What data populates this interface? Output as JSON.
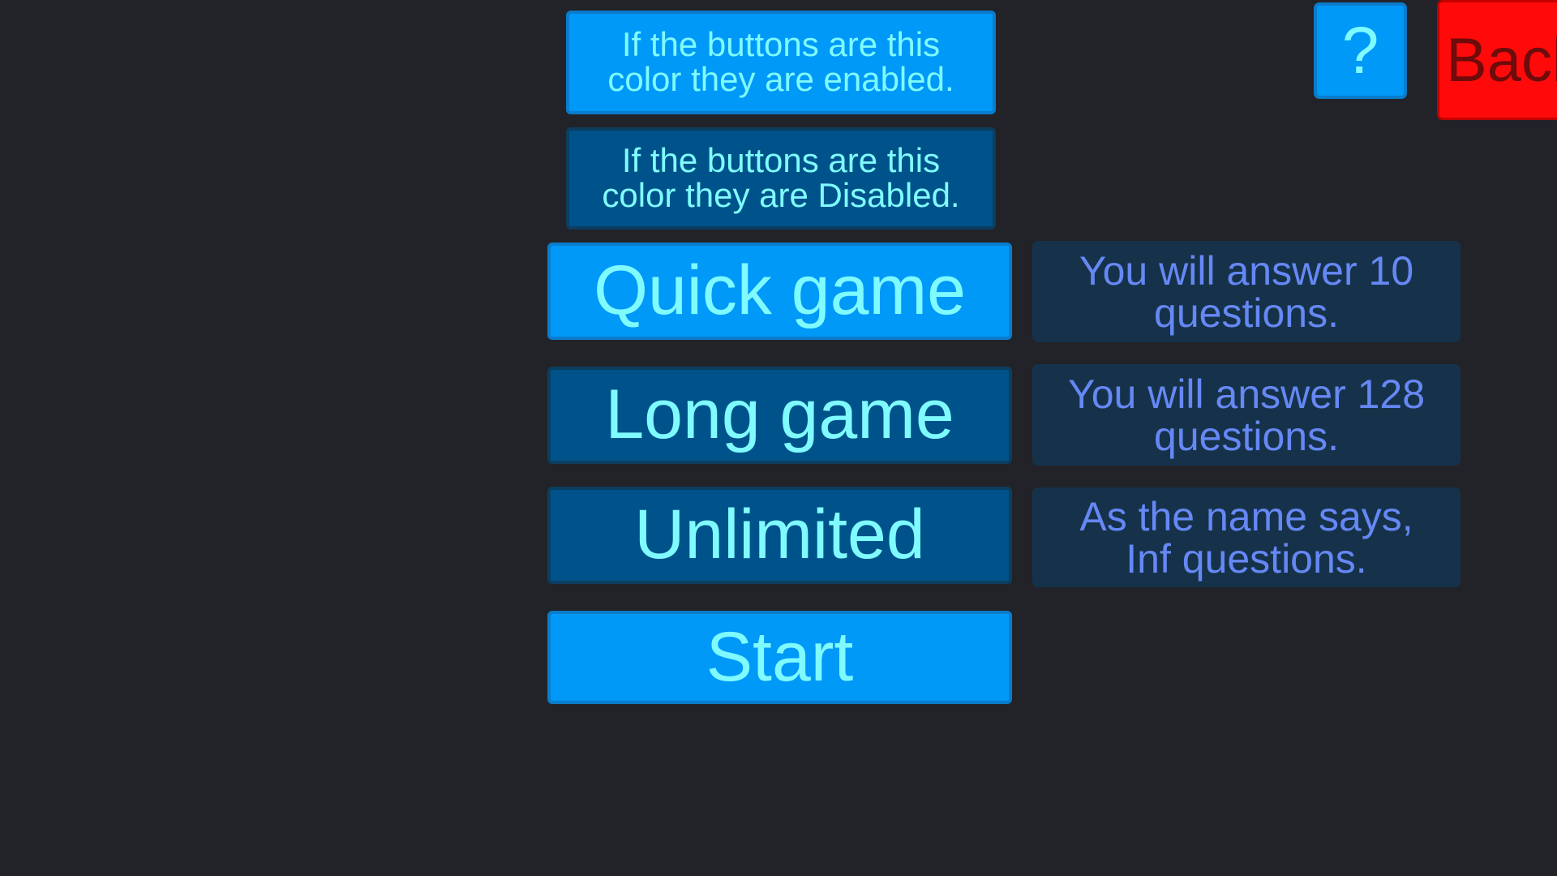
{
  "background_color": "#212328",
  "colors": {
    "enabled_button": "#0099F7",
    "disabled_button": "#00538A",
    "button_text": "#7FFBFF",
    "description_panel": "#16324A",
    "description_text": "#6688F5",
    "back_button": "#FF0A0A",
    "back_button_text": "#6E0B0B"
  },
  "legend": {
    "enabled_text": "If the buttons are this\ncolor they are enabled.",
    "disabled_text": "If the buttons are this\ncolor they are Disabled."
  },
  "modes": [
    {
      "label": "Quick game",
      "state": "enabled",
      "description": "You will answer 10\nquestions."
    },
    {
      "label": "Long game",
      "state": "disabled",
      "description": "You will answer 128\nquestions."
    },
    {
      "label": "Unlimited",
      "state": "disabled",
      "description": "As the name says,\nInf questions."
    }
  ],
  "actions": {
    "start_label": "Start",
    "start_state": "enabled"
  },
  "top_bar": {
    "help_label": "?",
    "help_icon": "question-mark-icon",
    "back_label": "Back"
  }
}
